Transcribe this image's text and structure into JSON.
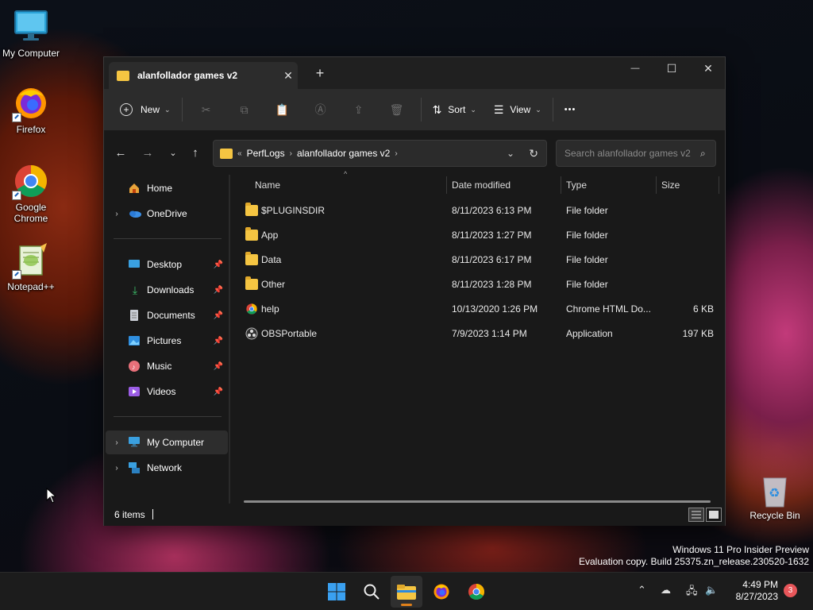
{
  "desktop": {
    "icons": [
      {
        "label": "My Computer",
        "icon": "monitor-icon"
      },
      {
        "label": "Firefox",
        "icon": "firefox-icon"
      },
      {
        "label": "Google Chrome",
        "icon": "chrome-icon"
      },
      {
        "label": "Notepad++",
        "icon": "notepadpp-icon"
      }
    ],
    "recycle_bin": "Recycle Bin",
    "watermark": {
      "line1": "Windows 11 Pro Insider Preview",
      "line2": "Evaluation copy. Build 25375.zn_release.230520-1632"
    }
  },
  "window": {
    "tab_title": "alanfollador games v2",
    "new_tab": "+",
    "controls": {
      "minimize": "—",
      "maximize": "☐",
      "close": "✕"
    }
  },
  "toolbar": {
    "new_label": "New",
    "sort_label": "Sort",
    "view_label": "View",
    "more": "•••"
  },
  "address": {
    "overflow": "«",
    "crumbs": [
      "PerfLogs",
      "alanfollador games v2"
    ],
    "search_placeholder": "Search alanfollador games v2"
  },
  "nav": {
    "home": "Home",
    "onedrive": "OneDrive",
    "quick_access": [
      {
        "label": "Desktop",
        "icon": "desktop-icon"
      },
      {
        "label": "Downloads",
        "icon": "downloads-icon"
      },
      {
        "label": "Documents",
        "icon": "documents-icon"
      },
      {
        "label": "Pictures",
        "icon": "pictures-icon"
      },
      {
        "label": "Music",
        "icon": "music-icon"
      },
      {
        "label": "Videos",
        "icon": "videos-icon"
      }
    ],
    "my_computer": "My Computer",
    "network": "Network"
  },
  "columns": {
    "name": "Name",
    "date": "Date modified",
    "type": "Type",
    "size": "Size"
  },
  "files": [
    {
      "name": "$PLUGINSDIR",
      "date": "8/11/2023 6:13 PM",
      "type": "File folder",
      "size": "",
      "kind": "folder"
    },
    {
      "name": "App",
      "date": "8/11/2023 1:27 PM",
      "type": "File folder",
      "size": "",
      "kind": "folder"
    },
    {
      "name": "Data",
      "date": "8/11/2023 6:17 PM",
      "type": "File folder",
      "size": "",
      "kind": "folder"
    },
    {
      "name": "Other",
      "date": "8/11/2023 1:28 PM",
      "type": "File folder",
      "size": "",
      "kind": "folder"
    },
    {
      "name": "help",
      "date": "10/13/2020 1:26 PM",
      "type": "Chrome HTML Do...",
      "size": "6 KB",
      "kind": "chrome"
    },
    {
      "name": "OBSPortable",
      "date": "7/9/2023 1:14 PM",
      "type": "Application",
      "size": "197 KB",
      "kind": "app"
    }
  ],
  "status": {
    "items": "6 items"
  },
  "taskbar": {
    "time": "4:49 PM",
    "date": "8/27/2023",
    "notifications": "3"
  },
  "colors": {
    "window_bg": "#191919",
    "toolbar_bg": "#2c2c2c",
    "folder": "#f5c542",
    "accent": "#e0801a"
  }
}
